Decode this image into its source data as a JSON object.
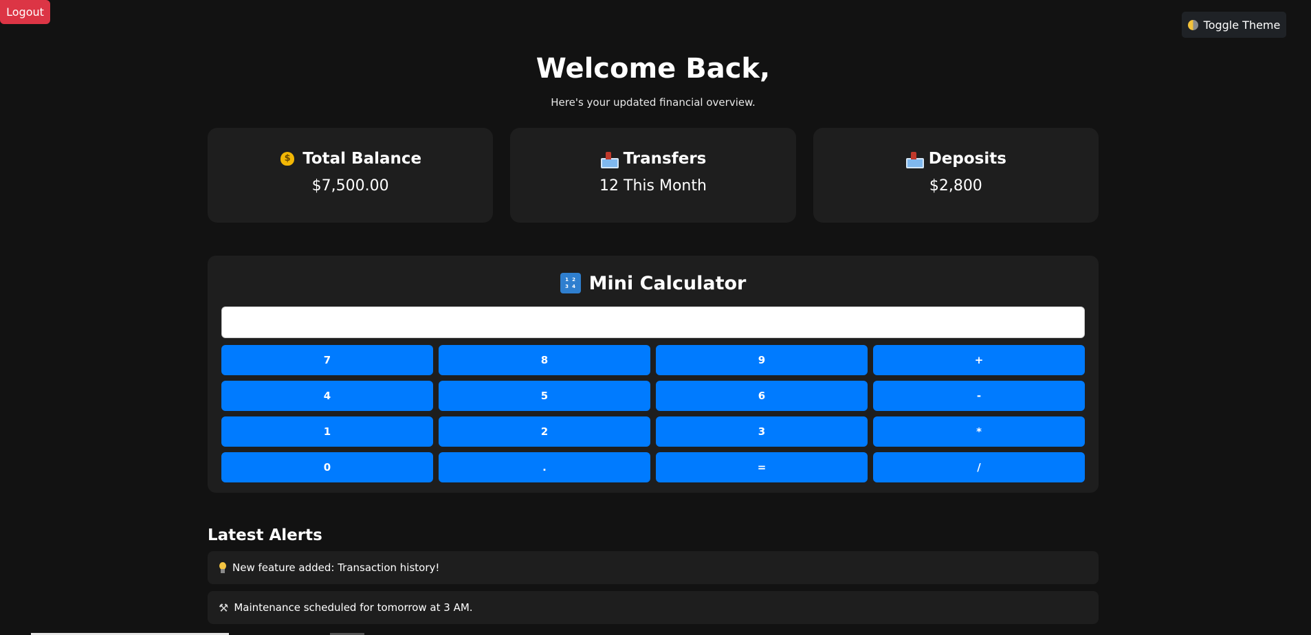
{
  "top_bar": {
    "logout_label": "Logout",
    "toggle_theme_label": "Toggle Theme"
  },
  "header": {
    "welcome": "Welcome Back,",
    "subtitle": "Here's your updated financial overview."
  },
  "cards": [
    {
      "icon": "money-bag-icon",
      "title": "Total Balance",
      "value": "$7,500.00"
    },
    {
      "icon": "outbox-tray-icon",
      "title": "Transfers",
      "value": "12 This Month"
    },
    {
      "icon": "inbox-tray-icon",
      "title": "Deposits",
      "value": "$2,800"
    }
  ],
  "calculator": {
    "title": "Mini Calculator",
    "display_value": "",
    "buttons": [
      "7",
      "8",
      "9",
      "+",
      "4",
      "5",
      "6",
      "-",
      "1",
      "2",
      "3",
      "*",
      "0",
      ".",
      "=",
      "/"
    ]
  },
  "alerts": {
    "title": "Latest Alerts",
    "items": [
      {
        "icon": "light-bulb-icon",
        "text": "New feature added: Transaction history!"
      },
      {
        "icon": "hammer-wrench-icon",
        "text": "Maintenance scheduled for tomorrow at 3 AM."
      }
    ]
  },
  "colors": {
    "background": "#121212",
    "card": "#1e1e1e",
    "accent": "#007bff",
    "danger": "#dc3545"
  }
}
